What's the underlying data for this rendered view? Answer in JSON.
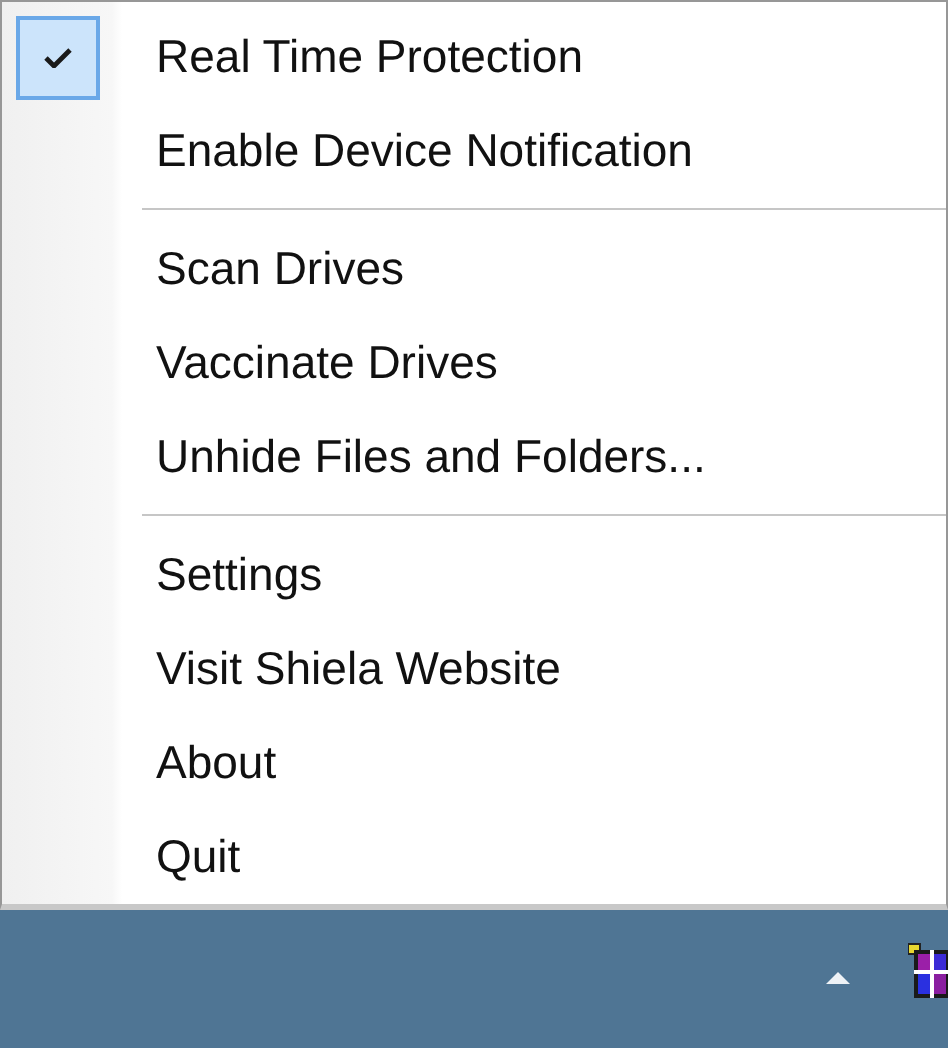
{
  "menu": {
    "items": [
      {
        "kind": "item",
        "label": "Real Time Protection",
        "checked": true
      },
      {
        "kind": "item",
        "label": "Enable Device Notification",
        "checked": false
      },
      {
        "kind": "separator"
      },
      {
        "kind": "item",
        "label": "Scan Drives",
        "checked": false
      },
      {
        "kind": "item",
        "label": "Vaccinate Drives",
        "checked": false
      },
      {
        "kind": "item",
        "label": "Unhide Files and Folders...",
        "checked": false
      },
      {
        "kind": "separator"
      },
      {
        "kind": "item",
        "label": "Settings",
        "checked": false
      },
      {
        "kind": "item",
        "label": "Visit Shiela Website",
        "checked": false
      },
      {
        "kind": "item",
        "label": "About",
        "checked": false
      },
      {
        "kind": "item",
        "label": "Quit",
        "checked": false
      }
    ]
  }
}
